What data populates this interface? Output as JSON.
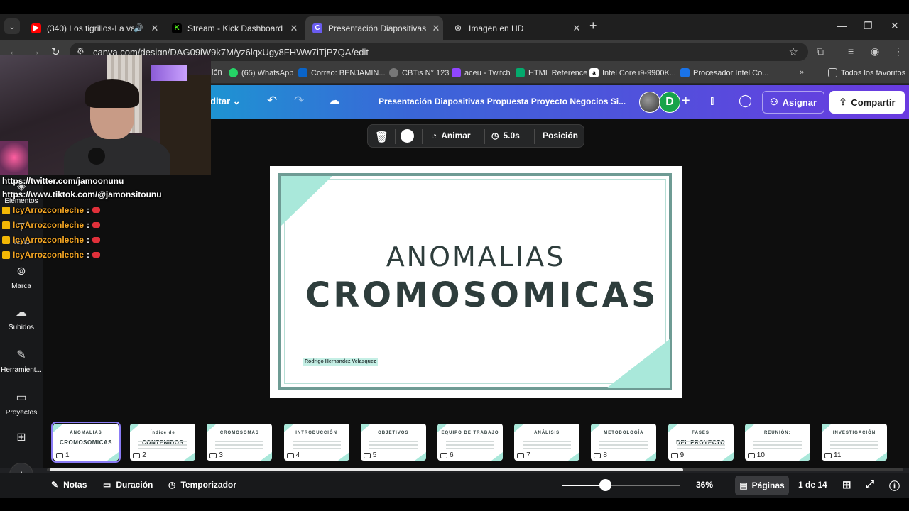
{
  "browser": {
    "tabs": [
      {
        "title": "(340) Los tigrillos-La vampira",
        "favicon_color": "#ff0000",
        "favicon_glyph": "▶"
      },
      {
        "title": "Stream - Kick Dashboard",
        "favicon_color": "#53fc18",
        "favicon_glyph": "K"
      },
      {
        "title": "Presentación Diapositivas Propuesta",
        "favicon_color": "#6a5cf0",
        "favicon_glyph": "C"
      },
      {
        "title": "Imagen en HD",
        "favicon_color": "#666666",
        "favicon_glyph": "◎"
      }
    ],
    "url": "canva.com/design/DAG09jW9k7M/yz6lqxUgy8FHWw7iTjP7QA/edit",
    "bookmarks": [
      {
        "label": "ión",
        "icon": ""
      },
      {
        "label": "(65) WhatsApp",
        "icon": "whatsapp-icon"
      },
      {
        "label": "Correo: BENJAMIN...",
        "icon": "outlook-icon"
      },
      {
        "label": "CBTis N° 123",
        "icon": "globe-icon"
      },
      {
        "label": "aceu - Twitch",
        "icon": "twitch-icon"
      },
      {
        "label": "HTML Reference",
        "icon": "w3-icon"
      },
      {
        "label": "Intel Core i9-9900K...",
        "icon": "amazon-icon"
      },
      {
        "label": "Procesador Intel Co...",
        "icon": "store-icon"
      }
    ],
    "all_bookmarks": "Todos los favoritos"
  },
  "canva": {
    "editar_label": "ditar",
    "doc_title": "Presentación Diapositivas Propuesta Proyecto Negocios Si...",
    "avatar_letter": "D",
    "asignar": "Asignar",
    "compartir": "Compartir",
    "toolbar": {
      "animar": "Animar",
      "duration": "5.0s",
      "posicion": "Posición"
    },
    "sidebar": [
      {
        "label": "Elementos",
        "icon": "elements-icon"
      },
      {
        "label": "Texto",
        "icon": "text-icon"
      },
      {
        "label": "Marca",
        "icon": "brand-icon"
      },
      {
        "label": "Subidos",
        "icon": "upload-icon"
      },
      {
        "label": "Herramient...",
        "icon": "tools-icon"
      },
      {
        "label": "Proyectos",
        "icon": "folder-icon"
      }
    ],
    "slide": {
      "title_line1": "ANOMALIAS",
      "title_line2": "CROMOSOMICAS",
      "author": "Rodrigo Hernandez Velasquez"
    },
    "thumbnails": [
      {
        "num": "1",
        "title": "ANOMALIAS",
        "subtitle": "CROMOSOMICAS"
      },
      {
        "num": "2",
        "title": "Índice de",
        "subtitle": "CONTENIDOS"
      },
      {
        "num": "3",
        "title": "CROMOSOMAS",
        "subtitle": ""
      },
      {
        "num": "4",
        "title": "INTRODUCCIÓN",
        "subtitle": ""
      },
      {
        "num": "5",
        "title": "OBJETIVOS",
        "subtitle": ""
      },
      {
        "num": "6",
        "title": "EQUIPO DE TRABAJO",
        "subtitle": ""
      },
      {
        "num": "7",
        "title": "ANÁLISIS",
        "subtitle": ""
      },
      {
        "num": "8",
        "title": "METODOLOGÍA",
        "subtitle": ""
      },
      {
        "num": "9",
        "title": "FASES",
        "subtitle": "DEL PROYECTO"
      },
      {
        "num": "10",
        "title": "REUNIÓN:",
        "subtitle": ""
      },
      {
        "num": "11",
        "title": "INVESTIGACIÓN",
        "subtitle": ""
      }
    ],
    "bottom": {
      "notas": "Notas",
      "duracion": "Duración",
      "temporizador": "Temporizador",
      "zoom": "36%",
      "zoom_fraction": 0.36,
      "paginas": "Páginas",
      "page_count": "1 de 14"
    }
  },
  "overlay": {
    "links": [
      "https://twitter.com/jamoonunu",
      "https://www.tiktok.com/@jamonsitounu"
    ],
    "chat": [
      {
        "user": "IcyArrozconleche",
        "sep": ":"
      },
      {
        "user": "IcyArrozconleche",
        "sep": ":"
      },
      {
        "user": "IcyArrozconleche",
        "sep": ":"
      },
      {
        "user": "IcyArrozconleche",
        "sep": ":"
      }
    ]
  }
}
